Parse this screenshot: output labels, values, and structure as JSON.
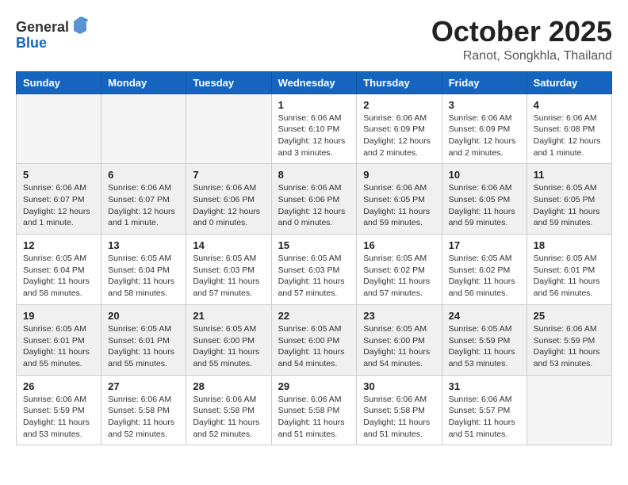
{
  "logo": {
    "general": "General",
    "blue": "Blue"
  },
  "title": "October 2025",
  "location": "Ranot, Songkhla, Thailand",
  "weekdays": [
    "Sunday",
    "Monday",
    "Tuesday",
    "Wednesday",
    "Thursday",
    "Friday",
    "Saturday"
  ],
  "weeks": [
    [
      {
        "day": "",
        "info": ""
      },
      {
        "day": "",
        "info": ""
      },
      {
        "day": "",
        "info": ""
      },
      {
        "day": "1",
        "info": "Sunrise: 6:06 AM\nSunset: 6:10 PM\nDaylight: 12 hours\nand 3 minutes."
      },
      {
        "day": "2",
        "info": "Sunrise: 6:06 AM\nSunset: 6:09 PM\nDaylight: 12 hours\nand 2 minutes."
      },
      {
        "day": "3",
        "info": "Sunrise: 6:06 AM\nSunset: 6:09 PM\nDaylight: 12 hours\nand 2 minutes."
      },
      {
        "day": "4",
        "info": "Sunrise: 6:06 AM\nSunset: 6:08 PM\nDaylight: 12 hours\nand 1 minute."
      }
    ],
    [
      {
        "day": "5",
        "info": "Sunrise: 6:06 AM\nSunset: 6:07 PM\nDaylight: 12 hours\nand 1 minute."
      },
      {
        "day": "6",
        "info": "Sunrise: 6:06 AM\nSunset: 6:07 PM\nDaylight: 12 hours\nand 1 minute."
      },
      {
        "day": "7",
        "info": "Sunrise: 6:06 AM\nSunset: 6:06 PM\nDaylight: 12 hours\nand 0 minutes."
      },
      {
        "day": "8",
        "info": "Sunrise: 6:06 AM\nSunset: 6:06 PM\nDaylight: 12 hours\nand 0 minutes."
      },
      {
        "day": "9",
        "info": "Sunrise: 6:06 AM\nSunset: 6:05 PM\nDaylight: 11 hours\nand 59 minutes."
      },
      {
        "day": "10",
        "info": "Sunrise: 6:06 AM\nSunset: 6:05 PM\nDaylight: 11 hours\nand 59 minutes."
      },
      {
        "day": "11",
        "info": "Sunrise: 6:05 AM\nSunset: 6:05 PM\nDaylight: 11 hours\nand 59 minutes."
      }
    ],
    [
      {
        "day": "12",
        "info": "Sunrise: 6:05 AM\nSunset: 6:04 PM\nDaylight: 11 hours\nand 58 minutes."
      },
      {
        "day": "13",
        "info": "Sunrise: 6:05 AM\nSunset: 6:04 PM\nDaylight: 11 hours\nand 58 minutes."
      },
      {
        "day": "14",
        "info": "Sunrise: 6:05 AM\nSunset: 6:03 PM\nDaylight: 11 hours\nand 57 minutes."
      },
      {
        "day": "15",
        "info": "Sunrise: 6:05 AM\nSunset: 6:03 PM\nDaylight: 11 hours\nand 57 minutes."
      },
      {
        "day": "16",
        "info": "Sunrise: 6:05 AM\nSunset: 6:02 PM\nDaylight: 11 hours\nand 57 minutes."
      },
      {
        "day": "17",
        "info": "Sunrise: 6:05 AM\nSunset: 6:02 PM\nDaylight: 11 hours\nand 56 minutes."
      },
      {
        "day": "18",
        "info": "Sunrise: 6:05 AM\nSunset: 6:01 PM\nDaylight: 11 hours\nand 56 minutes."
      }
    ],
    [
      {
        "day": "19",
        "info": "Sunrise: 6:05 AM\nSunset: 6:01 PM\nDaylight: 11 hours\nand 55 minutes."
      },
      {
        "day": "20",
        "info": "Sunrise: 6:05 AM\nSunset: 6:01 PM\nDaylight: 11 hours\nand 55 minutes."
      },
      {
        "day": "21",
        "info": "Sunrise: 6:05 AM\nSunset: 6:00 PM\nDaylight: 11 hours\nand 55 minutes."
      },
      {
        "day": "22",
        "info": "Sunrise: 6:05 AM\nSunset: 6:00 PM\nDaylight: 11 hours\nand 54 minutes."
      },
      {
        "day": "23",
        "info": "Sunrise: 6:05 AM\nSunset: 6:00 PM\nDaylight: 11 hours\nand 54 minutes."
      },
      {
        "day": "24",
        "info": "Sunrise: 6:05 AM\nSunset: 5:59 PM\nDaylight: 11 hours\nand 53 minutes."
      },
      {
        "day": "25",
        "info": "Sunrise: 6:06 AM\nSunset: 5:59 PM\nDaylight: 11 hours\nand 53 minutes."
      }
    ],
    [
      {
        "day": "26",
        "info": "Sunrise: 6:06 AM\nSunset: 5:59 PM\nDaylight: 11 hours\nand 53 minutes."
      },
      {
        "day": "27",
        "info": "Sunrise: 6:06 AM\nSunset: 5:58 PM\nDaylight: 11 hours\nand 52 minutes."
      },
      {
        "day": "28",
        "info": "Sunrise: 6:06 AM\nSunset: 5:58 PM\nDaylight: 11 hours\nand 52 minutes."
      },
      {
        "day": "29",
        "info": "Sunrise: 6:06 AM\nSunset: 5:58 PM\nDaylight: 11 hours\nand 51 minutes."
      },
      {
        "day": "30",
        "info": "Sunrise: 6:06 AM\nSunset: 5:58 PM\nDaylight: 11 hours\nand 51 minutes."
      },
      {
        "day": "31",
        "info": "Sunrise: 6:06 AM\nSunset: 5:57 PM\nDaylight: 11 hours\nand 51 minutes."
      },
      {
        "day": "",
        "info": ""
      }
    ]
  ]
}
